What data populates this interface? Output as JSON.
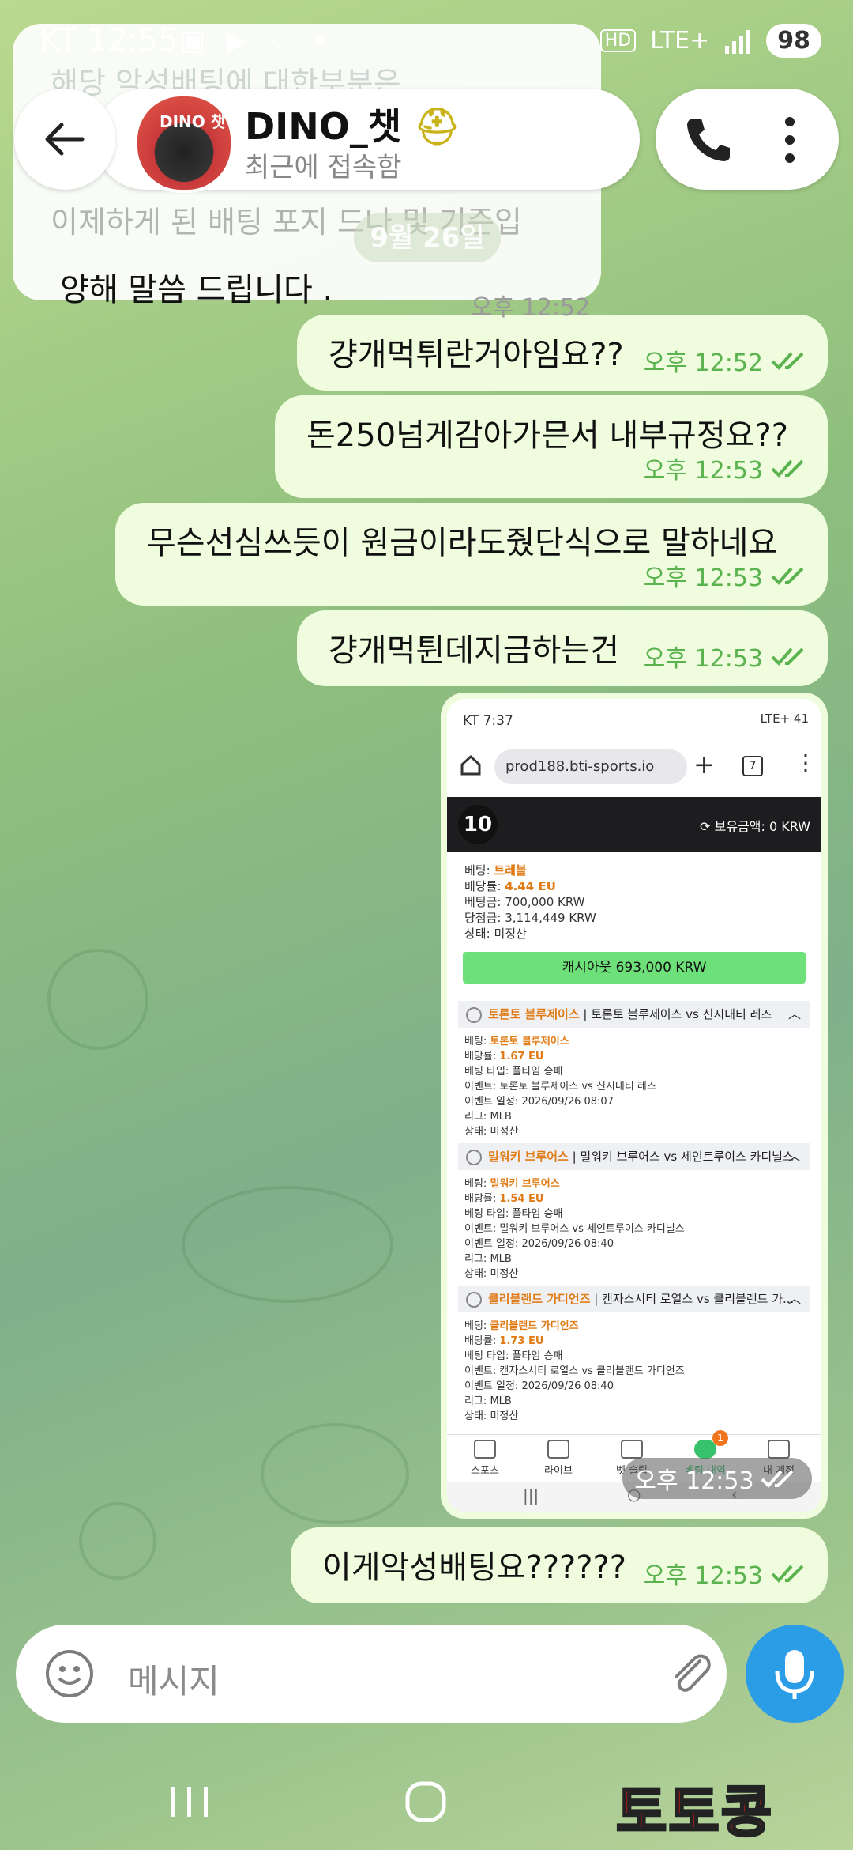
{
  "status_bar": {
    "carrier_time": "KT 12:55",
    "network": "LTE+",
    "battery": "98",
    "hd_label": "HD"
  },
  "header": {
    "contact_name": "DINO_챗",
    "contact_status": "최근에 접속함",
    "avatar_label": "DINO 챗"
  },
  "date_chip": "9월 26일",
  "incoming": {
    "faded_top": "해당 악성배팅에 대한부분은",
    "faded_mid": "이제하게 된 배팅 포지 드나 및 기준입",
    "visible_line": "양해 말씀 드립니다 .",
    "time": "오후 12:52"
  },
  "messages": [
    {
      "text": "걍개먹튀란거아임요??",
      "time": "오후 12:52"
    },
    {
      "text": "돈250넘게감아가믄서 내부규정요??",
      "time": "오후 12:53"
    },
    {
      "text": "무슨선심쓰듯이 원금이라도줬단식으로 말하네요",
      "time": "오후 12:53"
    },
    {
      "text": "걍개먹튄데지금하는건",
      "time": "오후 12:53"
    },
    {
      "text": "이게악성배팅요??????",
      "time": "오후 12:53"
    }
  ],
  "screenshot": {
    "time": "오후 12:53",
    "status_time": "KT 7:37",
    "status_right": "LTE+ 41",
    "url": "prod188.bti-sports.io",
    "tab_count": "7",
    "logo": "10",
    "balance": "보유금액: 0 KRW",
    "bet_summary": [
      {
        "label": "베팅: ",
        "value": "트레블"
      },
      {
        "label": "배당률: ",
        "value": "4.44 EU"
      },
      {
        "label": "베팅금: ",
        "value": "700,000 KRW"
      },
      {
        "label": "당첨금: ",
        "value": "3,114,449 KRW"
      },
      {
        "label": "상태: ",
        "value": "미정산"
      }
    ],
    "cashout": "캐시아웃 693,000 KRW",
    "legs": [
      {
        "team": "토론토 블루제이스",
        "match": "토론토 블루제이스 vs 신시내티 레즈",
        "bet": "토론토 블루제이스",
        "odds": "1.67 EU",
        "type": "풀타임 승패",
        "event": "토론토 블루제이스 vs 신시내티 레즈",
        "date": "2026/09/26 08:07",
        "league": "MLB",
        "status": "미정산"
      },
      {
        "team": "밀워키 브루어스",
        "match": "밀워키 브루어스 vs 세인트루이스 카디널스",
        "bet": "밀워키 브루어스",
        "odds": "1.54 EU",
        "type": "풀타임 승패",
        "event": "밀워키 브루어스 vs 세인트루이스 카디널스",
        "date": "2026/09/26 08:40",
        "league": "MLB",
        "status": "미정산"
      },
      {
        "team": "클리블랜드 가디언즈",
        "match": "캔자스시티 로열스 vs 클리블랜드 가...",
        "bet": "클리블랜드 가디언즈",
        "odds": "1.73 EU",
        "type": "풀타임 승패",
        "event": "캔자스시티 로열스 vs 클리블랜드 가디언즈",
        "date": "2026/09/26 08:40",
        "league": "MLB",
        "status": "미정산"
      }
    ],
    "field_labels": {
      "bet": "베팅: ",
      "odds": "배당률: ",
      "type": "베팅 타입: ",
      "event": "이벤트: ",
      "date": "이벤트 일정: ",
      "league": "리그: ",
      "status": "상태: "
    },
    "nav": [
      "스포츠",
      "라이브",
      "벳 슬립",
      "베팅 내역",
      "내 계정"
    ],
    "nav_badge": "1"
  },
  "composer": {
    "placeholder": "메시지"
  },
  "watermark": "토토콩",
  "colors": {
    "bubble_out": "#effdde",
    "check_green": "#5bb34f",
    "mic_blue": "#2b9ce6"
  }
}
